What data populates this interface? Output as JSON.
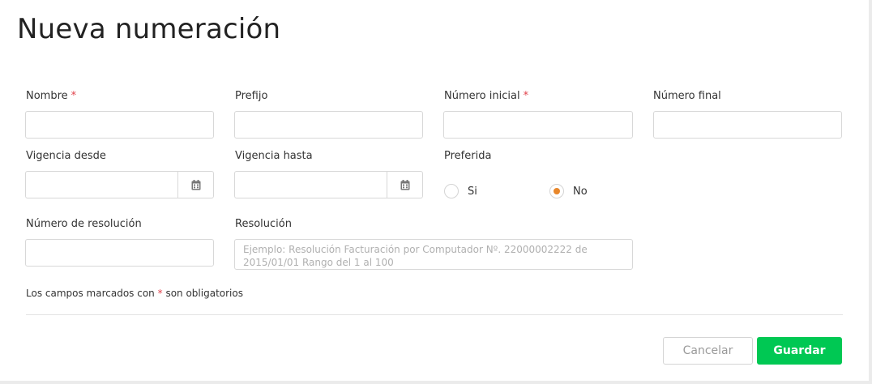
{
  "title": "Nueva numeración",
  "fields": {
    "nombre": {
      "label": "Nombre",
      "required_mark": "*",
      "value": ""
    },
    "prefijo": {
      "label": "Prefijo",
      "value": ""
    },
    "numero_inicial": {
      "label": "Número inicial",
      "required_mark": "*",
      "value": ""
    },
    "numero_final": {
      "label": "Número final",
      "value": ""
    },
    "vigencia_desde": {
      "label": "Vigencia desde",
      "value": "",
      "icon": "calendar-icon"
    },
    "vigencia_hasta": {
      "label": "Vigencia hasta",
      "value": "",
      "icon": "calendar-icon"
    },
    "preferida": {
      "label": "Preferida",
      "options": [
        "Si",
        "No"
      ],
      "selected": "No"
    },
    "numero_resolucion": {
      "label": "Número de resolución",
      "value": ""
    },
    "resolucion": {
      "label": "Resolución",
      "value": "",
      "placeholder": "Ejemplo: Resolución Facturación por Computador Nº. 22000002222 de 2015/01/01 Rango del 1 al 100"
    }
  },
  "footnote": {
    "prefix": "Los campos marcados con",
    "mark": "*",
    "suffix": "son obligatorios"
  },
  "buttons": {
    "cancel": "Cancelar",
    "save": "Guardar"
  },
  "colors": {
    "save_button": "#00c853",
    "required_mark": "#e0404a",
    "radio_selected": "#e8872b"
  }
}
